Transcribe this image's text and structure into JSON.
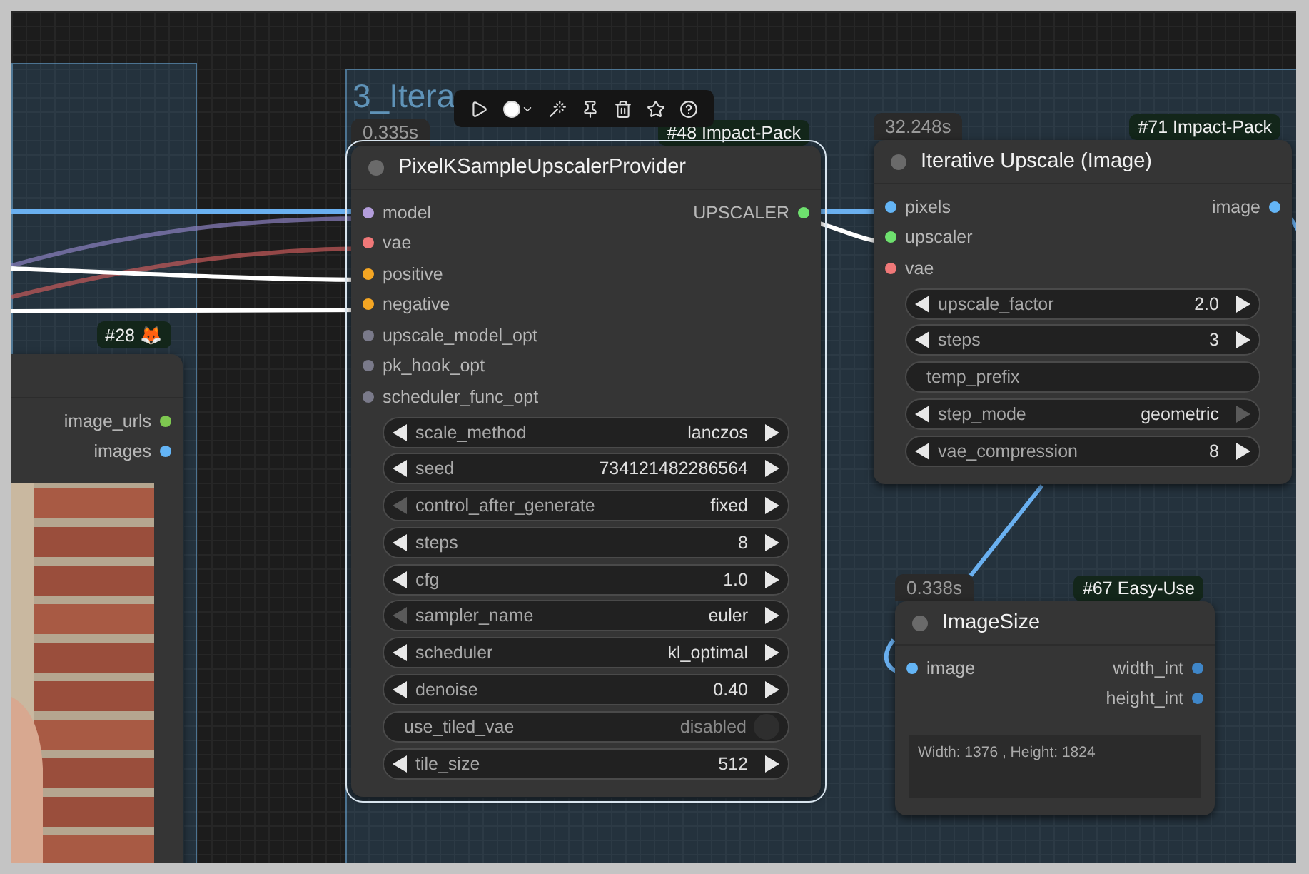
{
  "group": {
    "title": "3_Itera"
  },
  "nodes": [
    {
      "kind": "preview",
      "badge": "#28 🦊",
      "selected": false,
      "outputs": [
        {
          "name": "image_urls",
          "color": "#7ec850"
        },
        {
          "name": "images",
          "color": "#64b5f6"
        }
      ]
    },
    {
      "kind": "standard",
      "timing": "0.335s",
      "badge": "#48 Impact-Pack",
      "title": "PixelKSampleUpscalerProvider",
      "selected": true,
      "inputs": [
        {
          "name": "model",
          "color": "#b39ddb"
        },
        {
          "name": "vae",
          "color": "#f07878"
        },
        {
          "name": "positive",
          "color": "#f5a623"
        },
        {
          "name": "negative",
          "color": "#f5a623"
        },
        {
          "name": "upscale_model_opt",
          "color": "#7a7a8a"
        },
        {
          "name": "pk_hook_opt",
          "color": "#7a7a8a"
        },
        {
          "name": "scheduler_func_opt",
          "color": "#7a7a8a"
        }
      ],
      "outputs": [
        {
          "name": "UPSCALER",
          "color": "#6ee06e"
        }
      ],
      "widgets": [
        {
          "kind": "combo",
          "label": "scale_method",
          "value": "lanczos",
          "left_disabled": false,
          "right_disabled": false
        },
        {
          "kind": "combo",
          "label": "seed",
          "value": "734121482286564",
          "left_disabled": false,
          "right_disabled": false
        },
        {
          "kind": "combo",
          "label": "control_after_generate",
          "value": "fixed",
          "left_disabled": true,
          "right_disabled": false
        },
        {
          "kind": "combo",
          "label": "steps",
          "value": "8",
          "left_disabled": false,
          "right_disabled": false
        },
        {
          "kind": "combo",
          "label": "cfg",
          "value": "1.0",
          "left_disabled": false,
          "right_disabled": false
        },
        {
          "kind": "combo",
          "label": "sampler_name",
          "value": "euler",
          "left_disabled": true,
          "right_disabled": false
        },
        {
          "kind": "combo",
          "label": "scheduler",
          "value": "kl_optimal",
          "left_disabled": false,
          "right_disabled": false
        },
        {
          "kind": "combo",
          "label": "denoise",
          "value": "0.40",
          "left_disabled": false,
          "right_disabled": false
        },
        {
          "kind": "toggle",
          "label": "use_tiled_vae",
          "value": "disabled",
          "on": false
        },
        {
          "kind": "combo",
          "label": "tile_size",
          "value": "512",
          "left_disabled": false,
          "right_disabled": false
        }
      ]
    },
    {
      "kind": "standard",
      "timing": "32.248s",
      "badge": "#71 Impact-Pack",
      "title": "Iterative Upscale (Image)",
      "selected": false,
      "inputs": [
        {
          "name": "pixels",
          "color": "#64b5f6"
        },
        {
          "name": "upscaler",
          "color": "#6ee06e"
        },
        {
          "name": "vae",
          "color": "#f07878"
        }
      ],
      "outputs": [
        {
          "name": "image",
          "color": "#64b5f6"
        }
      ],
      "widgets": [
        {
          "kind": "combo",
          "label": "upscale_factor",
          "value": "2.0",
          "left_disabled": false,
          "right_disabled": false
        },
        {
          "kind": "combo",
          "label": "steps",
          "value": "3",
          "left_disabled": false,
          "right_disabled": false
        },
        {
          "kind": "text",
          "label": "temp_prefix"
        },
        {
          "kind": "combo",
          "label": "step_mode",
          "value": "geometric",
          "left_disabled": false,
          "right_disabled": true
        },
        {
          "kind": "combo",
          "label": "vae_compression",
          "value": "8",
          "left_disabled": false,
          "right_disabled": false
        }
      ]
    },
    {
      "kind": "standard",
      "timing": "0.338s",
      "badge": "#67 Easy-Use",
      "title": "ImageSize",
      "selected": false,
      "inputs": [
        {
          "name": "image",
          "color": "#64b5f6"
        }
      ],
      "outputs": [
        {
          "name": "width_int",
          "color": "#3f86c8"
        },
        {
          "name": "height_int",
          "color": "#3f86c8"
        }
      ],
      "info": "Width: 1376 , Height: 1824"
    }
  ]
}
